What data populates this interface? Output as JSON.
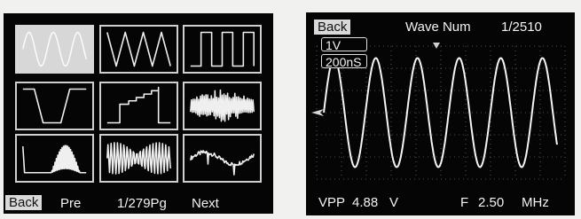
{
  "left_panel": {
    "thumbnails": [
      {
        "name": "wave-thumb-sine",
        "waveform": "sine",
        "selected": true
      },
      {
        "name": "wave-thumb-triangle",
        "waveform": "triangle",
        "selected": false
      },
      {
        "name": "wave-thumb-square",
        "waveform": "square",
        "selected": false
      },
      {
        "name": "wave-thumb-trapezoid",
        "waveform": "trapezoid",
        "selected": false
      },
      {
        "name": "wave-thumb-staircase",
        "waveform": "staircase",
        "selected": false
      },
      {
        "name": "wave-thumb-noise-burst",
        "waveform": "noise-burst",
        "selected": false
      },
      {
        "name": "wave-thumb-pulse-burst",
        "waveform": "pulse-burst",
        "selected": false
      },
      {
        "name": "wave-thumb-modulated",
        "waveform": "modulated",
        "selected": false
      },
      {
        "name": "wave-thumb-noisy-sine",
        "waveform": "noisy-sine",
        "selected": false
      }
    ],
    "menu": {
      "back": "Back",
      "pre": "Pre",
      "page": "1/279Pg",
      "next": "Next"
    }
  },
  "right_panel": {
    "header": {
      "back": "Back",
      "title": "Wave Num",
      "counter": "1/2510"
    },
    "volt_scale": "1V",
    "time_scale": "200nS",
    "footer": {
      "vpp_label": "VPP",
      "vpp_value": "4.88",
      "vpp_unit": "V",
      "freq_label": "F",
      "freq_value": "2.50",
      "freq_unit": "MHz"
    },
    "trace": {
      "cycles": 5.6,
      "amplitude_fraction": 0.82
    }
  }
}
